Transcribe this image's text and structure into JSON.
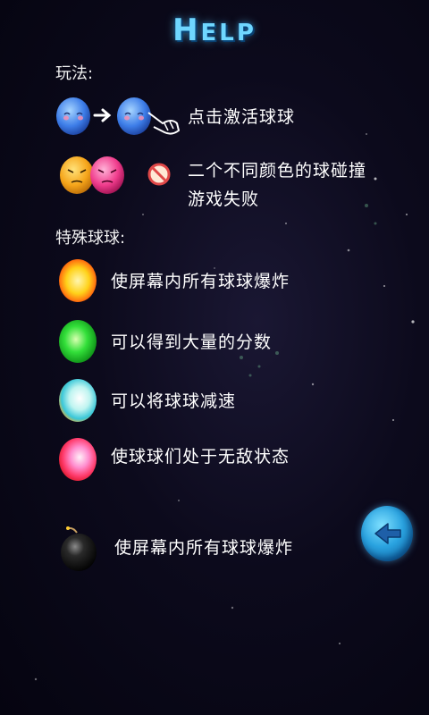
{
  "title": {
    "first": "H",
    "rest": "ELP"
  },
  "rules": {
    "label": "玩法:",
    "tap_text": "点击激活球球",
    "collide_line1": "二个不同颜色的球碰撞",
    "collide_line2": "游戏失败"
  },
  "special": {
    "label": "特殊球球:",
    "items": [
      {
        "icon": "yellow-ball-icon",
        "color": "#ffd21a",
        "text": "使屏幕内所有球球爆炸"
      },
      {
        "icon": "green-ball-icon",
        "color": "#33e03a",
        "text": "可以得到大量的分数"
      },
      {
        "icon": "cyan-ball-icon",
        "color": "#7fe8f0",
        "text": "可以将球球减速"
      },
      {
        "icon": "pink-ball-icon",
        "color": "#ff4f8a",
        "text": "使球球们处于无敌状态"
      },
      {
        "icon": "bomb-icon",
        "color": "#111111",
        "text": "使屏幕内所有球球爆炸"
      }
    ]
  },
  "back_button": {
    "icon": "back-arrow-icon"
  }
}
